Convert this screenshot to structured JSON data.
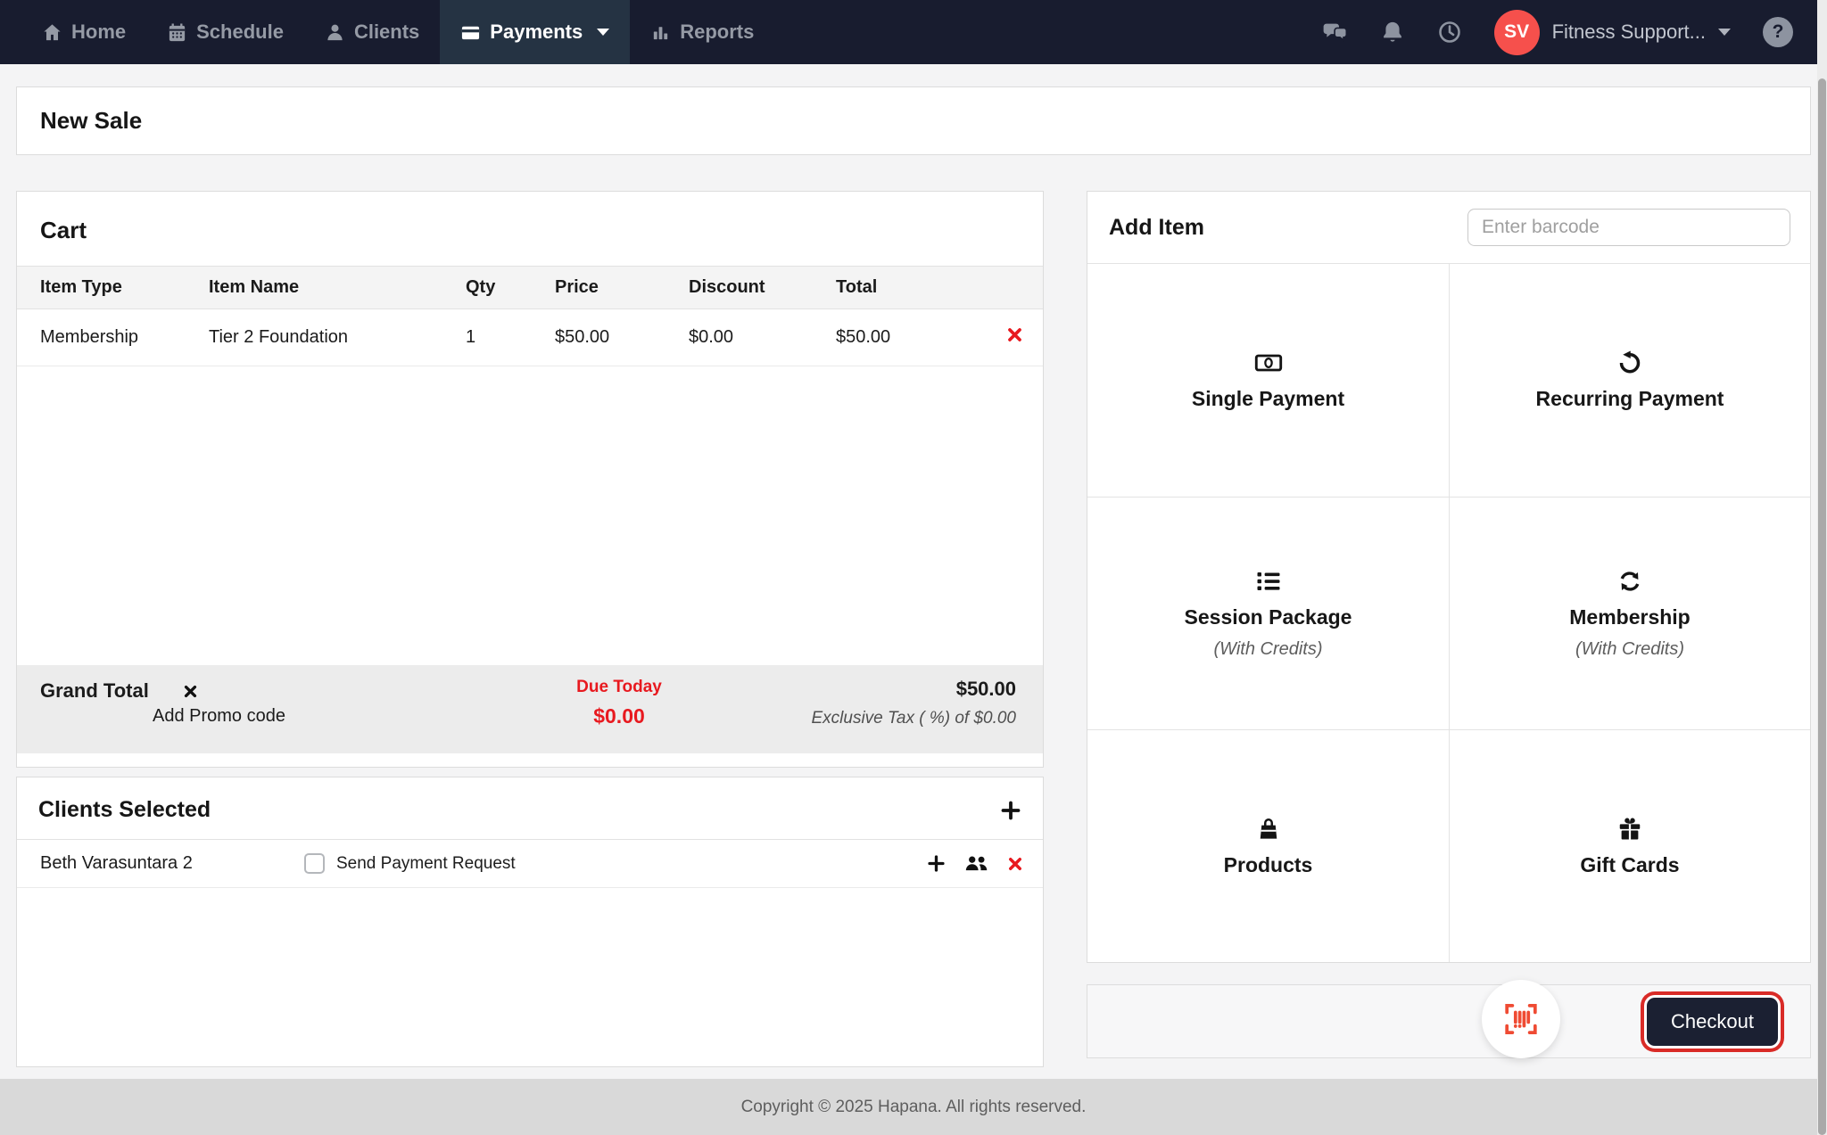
{
  "colors": {
    "navbar_bg": "#181c2f",
    "navbar_active_bg": "#253343",
    "accent_red": "#e8191f",
    "avatar_red": "#f6504c",
    "barcode_red": "#ef4b33",
    "checkout_bg": "#1b2032",
    "checkout_ring": "#d92b27",
    "footer_bg": "#d9d9d9",
    "page_bg": "#f4f4f5"
  },
  "nav": {
    "items": [
      {
        "label": "Home"
      },
      {
        "label": "Schedule"
      },
      {
        "label": "Clients"
      },
      {
        "label": "Payments",
        "active": true
      },
      {
        "label": "Reports"
      }
    ],
    "user_initials": "SV",
    "user_name": "Fitness Support..."
  },
  "page": {
    "title": "New Sale"
  },
  "cart": {
    "title": "Cart",
    "columns": [
      "Item Type",
      "Item Name",
      "Qty",
      "Price",
      "Discount",
      "Total"
    ],
    "rows": [
      {
        "item_type": "Membership",
        "item_name": "Tier 2 Foundation",
        "qty": "1",
        "price": "$50.00",
        "discount": "$0.00",
        "total": "$50.00"
      }
    ],
    "grand_total_label": "Grand Total",
    "promo_label": "Add Promo code",
    "due_today_label": "Due Today",
    "due_today_value": "$0.00",
    "grand_total_value": "$50.00",
    "tax_note": "Exclusive Tax ( %) of $0.00"
  },
  "clients": {
    "title": "Clients Selected",
    "rows": [
      {
        "name": "Beth Varasuntara 2",
        "request_label": "Send Payment Request",
        "checked": false
      }
    ]
  },
  "add_item": {
    "title": "Add Item",
    "barcode_placeholder": "Enter barcode",
    "tiles": [
      {
        "label": "Single Payment",
        "sub": ""
      },
      {
        "label": "Recurring Payment",
        "sub": ""
      },
      {
        "label": "Session Package",
        "sub": "(With Credits)"
      },
      {
        "label": "Membership",
        "sub": "(With Credits)"
      },
      {
        "label": "Products",
        "sub": ""
      },
      {
        "label": "Gift Cards",
        "sub": ""
      }
    ]
  },
  "checkout": {
    "label": "Checkout"
  },
  "footer": {
    "text": "Copyright © 2025 Hapana. All rights reserved."
  }
}
